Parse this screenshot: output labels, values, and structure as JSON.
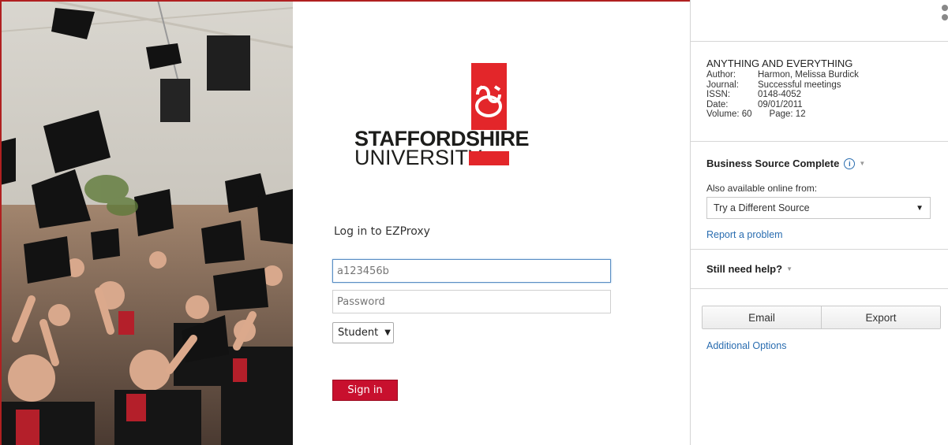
{
  "login": {
    "logo_line1": "STAFFORDSHIRE",
    "logo_line2": "UNIVERSITY",
    "title": "Log in to EZProxy",
    "username_placeholder": "a123456b",
    "password_placeholder": "Password",
    "role_selected": "Student",
    "signin_label": "Sign in",
    "accent": "#c8102e",
    "logo_red": "#e3262a"
  },
  "record": {
    "title": "ANYTHING AND EVERYTHING",
    "author_label": "Author:",
    "author": "Harmon, Melissa Burdick",
    "journal_label": "Journal:",
    "journal": "Successful meetings",
    "issn_label": "ISSN:",
    "issn": "0148-4052",
    "date_label": "Date:",
    "date": "09/01/2011",
    "volume": "Volume: 60",
    "page": "Page: 12"
  },
  "sidebar": {
    "source_title": "Business Source Complete",
    "also_available": "Also available online from:",
    "source_select": "Try a Different Source",
    "report_link": "Report a problem",
    "help_title": "Still need help?",
    "email_button": "Email",
    "export_button": "Export",
    "additional_link": "Additional Options",
    "link_color": "#2a6db0"
  }
}
